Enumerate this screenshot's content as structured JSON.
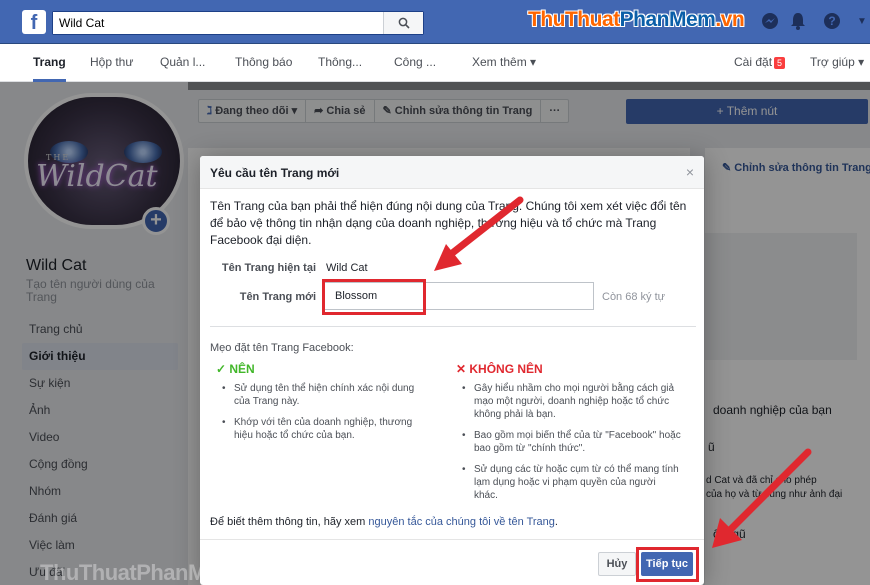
{
  "topbar": {
    "logo": "f",
    "search_value": "Wild Cat",
    "watermark_parts": [
      "Thu",
      "Thuat",
      "PhanMem",
      ".vn"
    ]
  },
  "nav": {
    "items": [
      "Trang",
      "Hộp thư",
      "Quản l...",
      "Thông báo",
      "Thông...",
      "Công ...",
      "Xem thêm ▾"
    ],
    "settings": "Cài đặt",
    "settings_badge": "5",
    "help": "Trợ giúp ▾"
  },
  "page": {
    "avatar_the": "THE",
    "avatar_logo": "WildCat",
    "name": "Wild Cat",
    "username_hint": "Tạo tên người dùng của Trang"
  },
  "left_menu": [
    "Trang chủ",
    "Giới thiệu",
    "Sự kiện",
    "Ảnh",
    "Video",
    "Cộng đồng",
    "Nhóm",
    "Đánh giá",
    "Việc làm",
    "Ưu đãi"
  ],
  "actions": {
    "following": "Đang theo dõi ▾",
    "share": "Chia sẻ",
    "edit_page_info": "Chỉnh sửa thông tin Trang",
    "more": "···",
    "add_button": "+ Thêm nút"
  },
  "right_panel": {
    "edit_link": "Chỉnh sửa thông tin Trang",
    "business": "doanh nghiệp của bạn",
    "cropped_heading": "ũ",
    "cropped_text_1": "d Cat và đã chỉ cho phép",
    "cropped_text_2": "của họ và từ cũng như ảnh đại",
    "team": "ội ngũ"
  },
  "dialog": {
    "title": "Yêu cầu tên Trang mới",
    "close": "×",
    "description": "Tên Trang của bạn phải thể hiện đúng nội dung của Trang. Chúng tôi xem xét việc đổi tên để bảo vệ thông tin nhận dạng của doanh nghiệp, thương hiệu và tổ chức mà Trang Facebook đại diện.",
    "current_label": "Tên Trang hiện tại",
    "current_value": "Wild Cat",
    "new_label": "Tên Trang mới",
    "new_value": "Blossom",
    "remaining": "Còn 68 ký tự",
    "tips_title": "Mẹo đặt tên Trang Facebook:",
    "do_title": "✓  NÊN",
    "do_items": [
      "Sử dụng tên thể hiện chính xác nội dung của Trang này.",
      "Khớp với tên của doanh nghiệp, thương hiệu hoặc tổ chức của bạn."
    ],
    "dont_title": "✕  KHÔNG NÊN",
    "dont_items": [
      "Gây hiểu nhầm cho mọi người bằng cách giả mạo một người, doanh nghiệp hoặc tổ chức không phải là bạn.",
      "Bao gồm mọi biến thể của từ \"Facebook\" hoặc bao gồm từ \"chính thức\".",
      "Sử dụng các từ hoặc cụm từ có thể mang tính lạm dụng hoặc vi phạm quyền của người khác."
    ],
    "more_info_prefix": "Để biết thêm thông tin, hãy xem ",
    "more_info_link": "nguyên tắc của chúng tôi về tên Trang",
    "more_info_suffix": ".",
    "cancel": "Hủy",
    "continue": "Tiếp tục"
  },
  "watermark_bottom": "ThuThuatPhanMem.vn",
  "colors": {
    "fb_blue": "#4267b2",
    "annotation_red": "#e0282f",
    "do_green": "#42b72a"
  }
}
